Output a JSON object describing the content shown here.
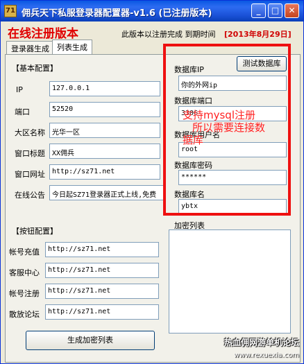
{
  "window": {
    "app_icon_text": "71",
    "title": "佣兵天下私服登录器配置器-v1.6   (已注册版本)",
    "controls": {
      "minimize": "_",
      "maximize": "□",
      "close": "✕"
    }
  },
  "header": {
    "online_version": "在线注册版本",
    "notice": "此版本以注册完成 到期时间",
    "expire_date": "[2013年8月29日]"
  },
  "tabs": [
    {
      "label": "登录器生成",
      "active": false
    },
    {
      "label": "列表生成",
      "active": true
    }
  ],
  "basic": {
    "heading": "【基本配置】",
    "rows": [
      {
        "label": "IP",
        "value": "127.0.0.1"
      },
      {
        "label": "端口",
        "value": "52520"
      },
      {
        "label": "大区名称",
        "value": "光华一区"
      },
      {
        "label": "窗口标题",
        "value": "XX佣兵"
      },
      {
        "label": "窗口网址",
        "value": "http://sz71.net"
      },
      {
        "label": "在线公告",
        "value": "今日起SZ71登录器正式上线,免费"
      }
    ]
  },
  "buttons_cfg": {
    "heading": "【按钮配置】",
    "rows": [
      {
        "label": "帐号充值",
        "value": "http://sz71.net"
      },
      {
        "label": "客服中心",
        "value": "http://sz71.net"
      },
      {
        "label": "帐号注册",
        "value": "http://sz71.net"
      },
      {
        "label": "散放论坛",
        "value": "http://sz71.net"
      }
    ],
    "generate_label": "生成加密列表"
  },
  "database": {
    "test_button": "测试数据库",
    "ip_label": "数据库IP",
    "ip_value": "你的外网ip",
    "port_label": "数据库端口",
    "port_value": "3306",
    "user_label": "数据库用户名",
    "user_value": "root",
    "pass_label": "数据库密码",
    "pass_value": "******",
    "name_label": "数据库名",
    "name_value": "ybtx"
  },
  "annotation": {
    "line1": "支持mysql注册",
    "line2": "所以需要连接数",
    "line3": "据库"
  },
  "encrypt_list_label": "加密列表",
  "watermark": {
    "text": "热血佣网游单机论坛",
    "url": "www.rexuexia.com"
  },
  "colors": {
    "title_red": "#e00000",
    "annotation_red": "#ff2020",
    "titlebar_blue": "#0a58e2"
  }
}
